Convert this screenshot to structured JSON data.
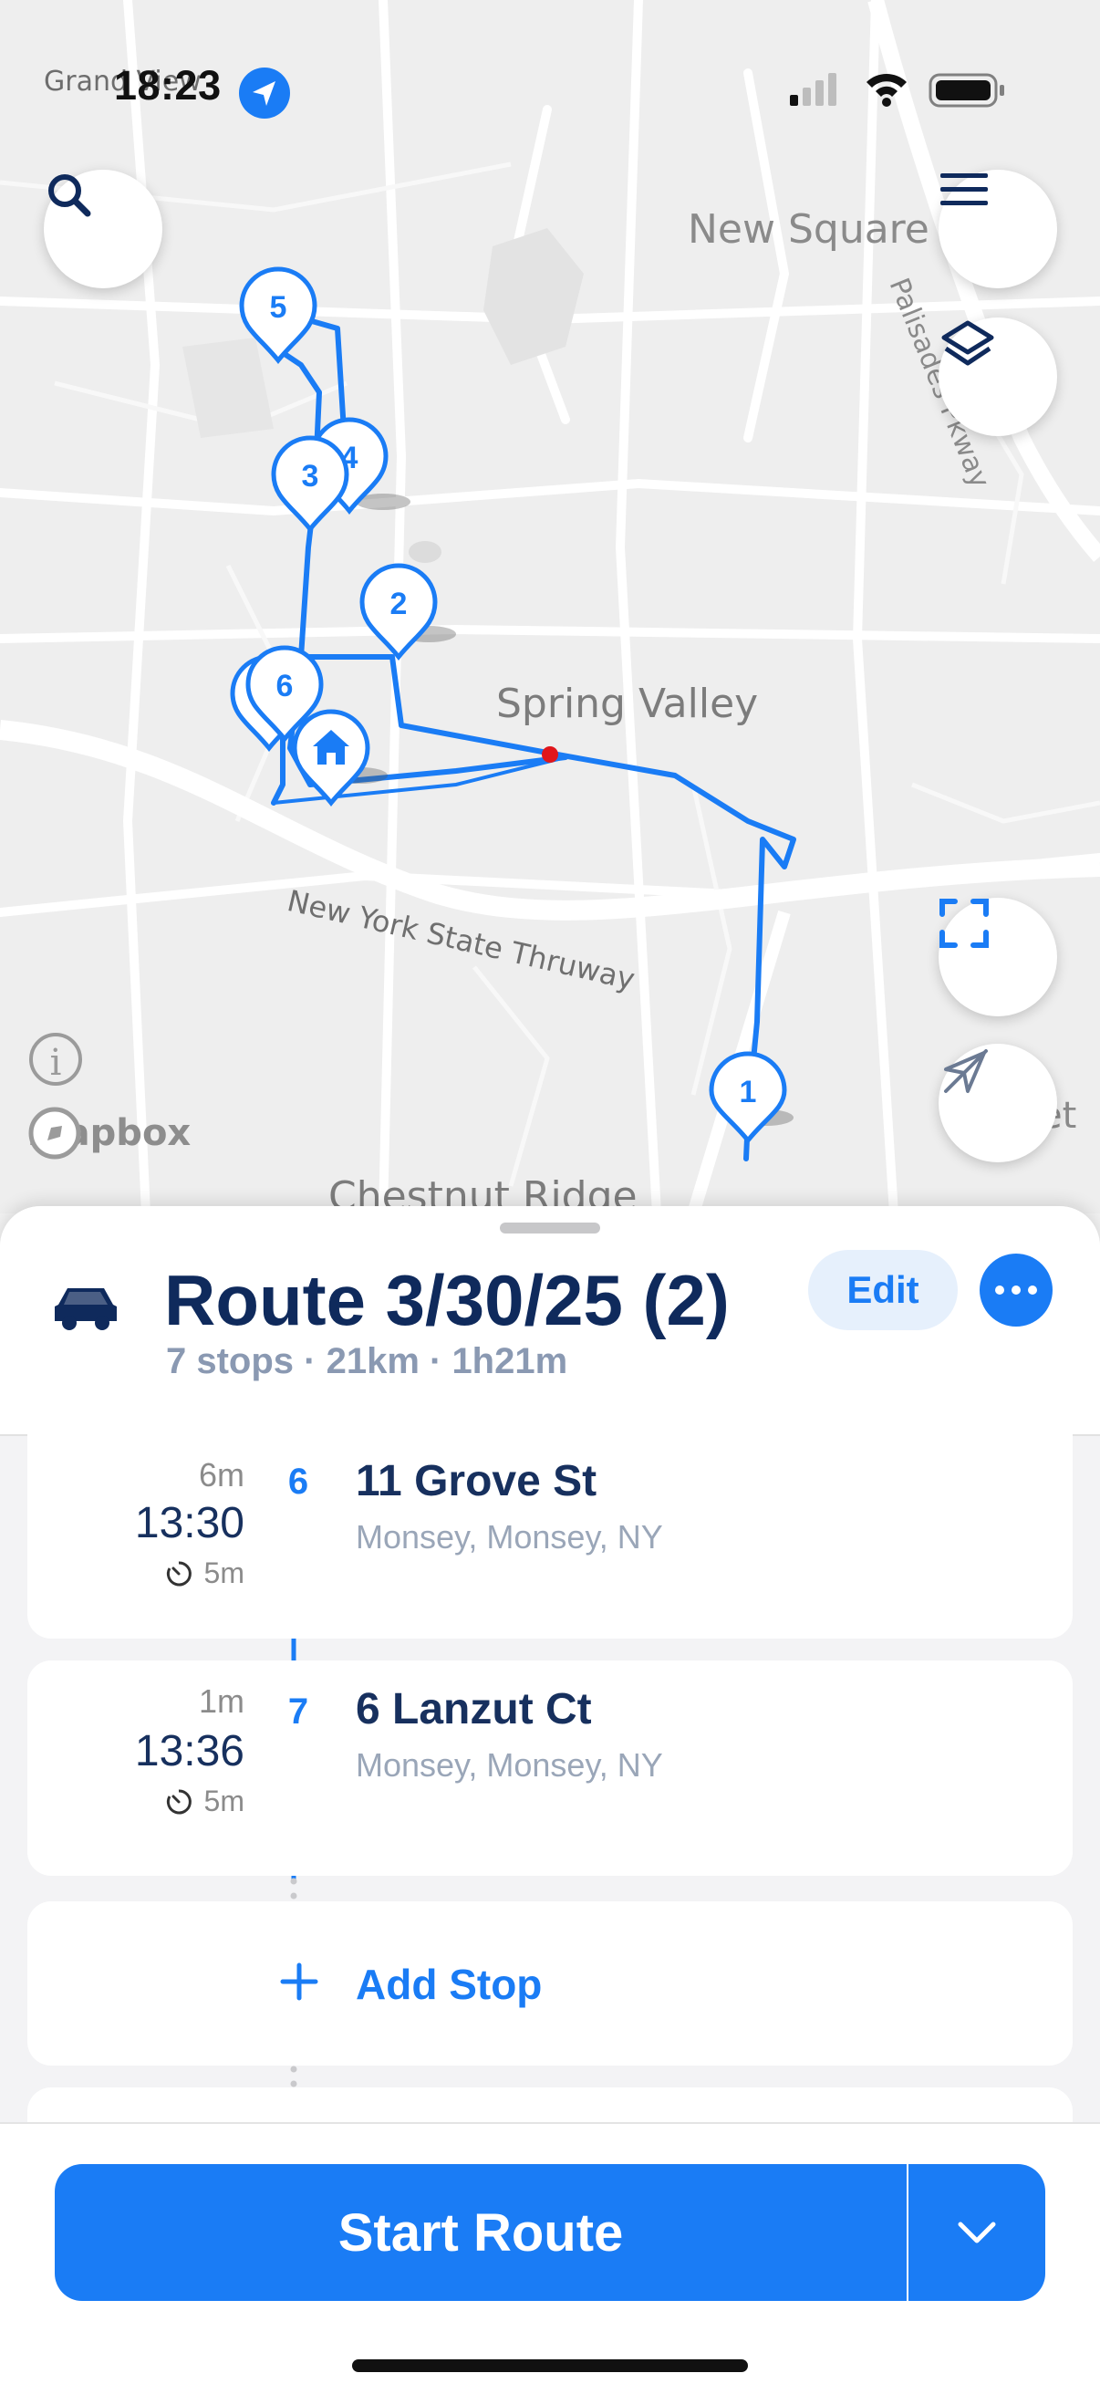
{
  "status_bar": {
    "time": "18:23"
  },
  "map": {
    "labels": {
      "grand_view": "Grand View",
      "new_square": "New Square",
      "palisades": "Palisades Pkway",
      "spring_valley": "Spring Valley",
      "thruway": "New York State Thruway",
      "chestnut_ridge": "Chestnut Ridge",
      "et": "et"
    },
    "markers": [
      "1",
      "2",
      "3",
      "4",
      "5",
      "6",
      "7"
    ],
    "attribution": "mapbox",
    "info_glyph": "i",
    "colors": {
      "route": "#1a7cf5",
      "marker_fill": "#ffffff",
      "current_location": "#e0161b"
    }
  },
  "sheet": {
    "route_name": "Route 3/30/25 (2)",
    "summary": "7 stops · 21km · 1h21m",
    "edit_label": "Edit",
    "stops": [
      {
        "number": "6",
        "drive": "6m",
        "eta": "13:30",
        "service": "5m",
        "title": "11 Grove St",
        "address": "Monsey, Monsey, NY"
      },
      {
        "number": "7",
        "drive": "1m",
        "eta": "13:36",
        "service": "5m",
        "title": "6 Lanzut Ct",
        "address": "Monsey, Monsey, NY"
      }
    ],
    "add_stop_label": "Add Stop"
  },
  "footer": {
    "start_label": "Start Route"
  },
  "colors": {
    "accent": "#1a7cf5",
    "title_navy": "#0f2a5c",
    "subtitle_gray": "#8a99b2"
  },
  "icons": [
    "search-icon",
    "menu-icon",
    "layers-icon",
    "expand-icon",
    "recenter-icon",
    "car-icon",
    "more-icon",
    "timer-icon",
    "plus-icon",
    "chevron-down-icon",
    "home-icon"
  ]
}
